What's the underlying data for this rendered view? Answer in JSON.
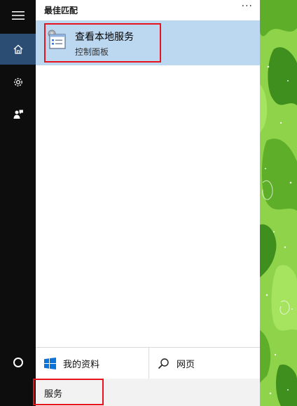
{
  "sidebar": {
    "icons": [
      "hamburger-icon",
      "home-icon",
      "gear-icon",
      "feedback-icon",
      "cortana-circle-icon"
    ]
  },
  "results": {
    "section_title": "最佳匹配",
    "more_label": "···",
    "best_match": {
      "title": "查看本地服务",
      "subtitle": "控制面板",
      "icon": "services-icon"
    }
  },
  "tabs": {
    "mine": {
      "label": "我的资料",
      "icon": "windows-logo-icon"
    },
    "web": {
      "label": "网页",
      "icon": "search-icon"
    }
  },
  "search": {
    "query": "服务"
  },
  "colors": {
    "rail": "#0d0d0d",
    "rail_active": "#2b4d73",
    "selection": "#bcd8f1",
    "highlight": "#e8141d",
    "wallpaper_green": "#7fc93a"
  }
}
